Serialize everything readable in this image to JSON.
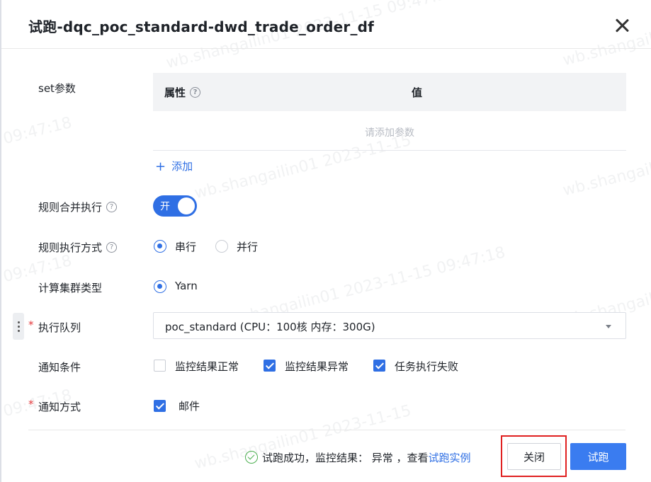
{
  "dialog": {
    "title": "试跑-dqc_poc_standard-dwd_trade_order_df"
  },
  "set_params": {
    "label": "set参数",
    "columns": [
      "属性",
      "值"
    ],
    "empty_text": "请添加参数",
    "add_label": "添加"
  },
  "merge_rule": {
    "label": "规则合并执行",
    "switch_text": "开",
    "enabled": true
  },
  "exec_mode": {
    "label": "规则执行方式",
    "options": [
      "串行",
      "并行"
    ],
    "selected": "串行"
  },
  "cluster_type": {
    "label": "计算集群类型",
    "options": [
      "Yarn"
    ],
    "selected": "Yarn"
  },
  "queue": {
    "label": "执行队列",
    "value": "poc_standard (CPU：100核 内存：300G)"
  },
  "notify_condition": {
    "label": "通知条件",
    "options": [
      {
        "label": "监控结果正常",
        "checked": false
      },
      {
        "label": "监控结果异常",
        "checked": true
      },
      {
        "label": "任务执行失败",
        "checked": true
      }
    ]
  },
  "notify_method": {
    "label": "通知方式",
    "options": [
      {
        "label": "邮件",
        "checked": true
      }
    ]
  },
  "footer": {
    "status_text": "试跑成功，监控结果： 异常 ，查看",
    "status_link": "试跑实例",
    "close_label": "关闭",
    "run_label": "试跑"
  },
  "watermark": {
    "user": "wb.shangailin01",
    "date": "2023-11-15",
    "time": "09:47:18"
  },
  "colors": {
    "primary": "#2f6fe4",
    "required": "#e4393c",
    "success": "#4caf50",
    "highlight_box": "#e02020"
  }
}
